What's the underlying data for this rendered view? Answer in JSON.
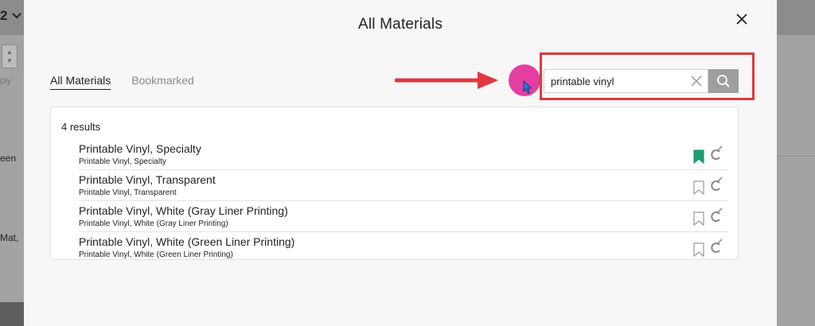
{
  "background": {
    "number_fragment": "2",
    "text_ply": "ply",
    "text_een": "een",
    "text_mat": "Mat,"
  },
  "dialog": {
    "title": "All Materials",
    "tabs": [
      {
        "label": "All Materials",
        "active": true
      },
      {
        "label": "Bookmarked",
        "active": false
      }
    ],
    "search": {
      "value": "printable vinyl",
      "placeholder": ""
    },
    "results_count": "4 results",
    "results": [
      {
        "name": "Printable Vinyl, Specialty",
        "subtitle": "Printable Vinyl, Specialty",
        "bookmarked": true
      },
      {
        "name": "Printable Vinyl, Transparent",
        "subtitle": "Printable Vinyl, Transparent",
        "bookmarked": false
      },
      {
        "name": "Printable Vinyl, White (Gray Liner Printing)",
        "subtitle": "Printable Vinyl, White (Gray Liner Printing)",
        "bookmarked": false
      },
      {
        "name": "Printable Vinyl, White (Green Liner Printing)",
        "subtitle": "Printable Vinyl, White (Green Liner Printing)",
        "bookmarked": false
      }
    ]
  },
  "icons": {
    "close": "close-icon",
    "clear": "clear-icon",
    "search": "search-icon",
    "bookmark": "bookmark-icon",
    "machine": "cricut-machine-icon"
  },
  "colors": {
    "bookmark_active": "#1f9d6e",
    "highlight": "#e0393d",
    "cursor": "#e33fa3",
    "search_button": "#9e9e9e"
  }
}
